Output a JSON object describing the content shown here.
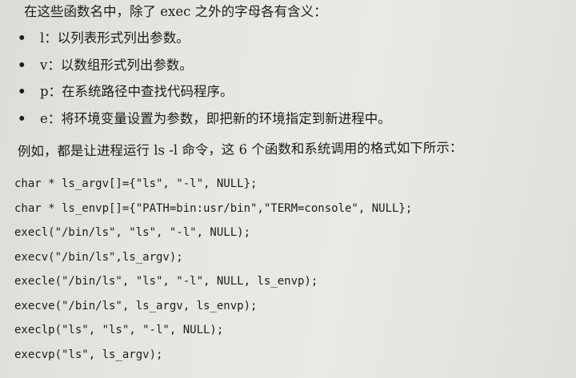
{
  "intro": "在这些函数名中，除了 exec 之外的字母各有含义：",
  "bullets": [
    {
      "symbol": "•",
      "text": "l：以列表形式列出参数。"
    },
    {
      "symbol": "•",
      "text": "v：以数组形式列出参数。"
    },
    {
      "symbol": "•",
      "text": "p：在系统路径中查找代码程序。"
    },
    {
      "symbol": "•",
      "text": "e：将环境变量设置为参数，即把新的环境指定到新进程中。"
    }
  ],
  "summary": "例如，都是让进程运行 ls -l 命令，这 6 个函数和系统调用的格式如下所示：",
  "code_lines": [
    "char * ls_argv[]={\"ls\", \"-l\", NULL};",
    "char * ls_envp[]={\"PATH=bin:usr/bin\",\"TERM=console\", NULL};",
    "execl(\"/bin/ls\", \"ls\", \"-l\", NULL);",
    "execv(\"/bin/ls\",ls_argv);",
    "execle(\"/bin/ls\", \"ls\", \"-l\", NULL, ls_envp);",
    "execve(\"/bin/ls\", ls_argv, ls_envp);",
    "execlp(\"ls\", \"ls\", \"-l\", NULL);",
    "execvp(\"ls\", ls_argv);"
  ]
}
